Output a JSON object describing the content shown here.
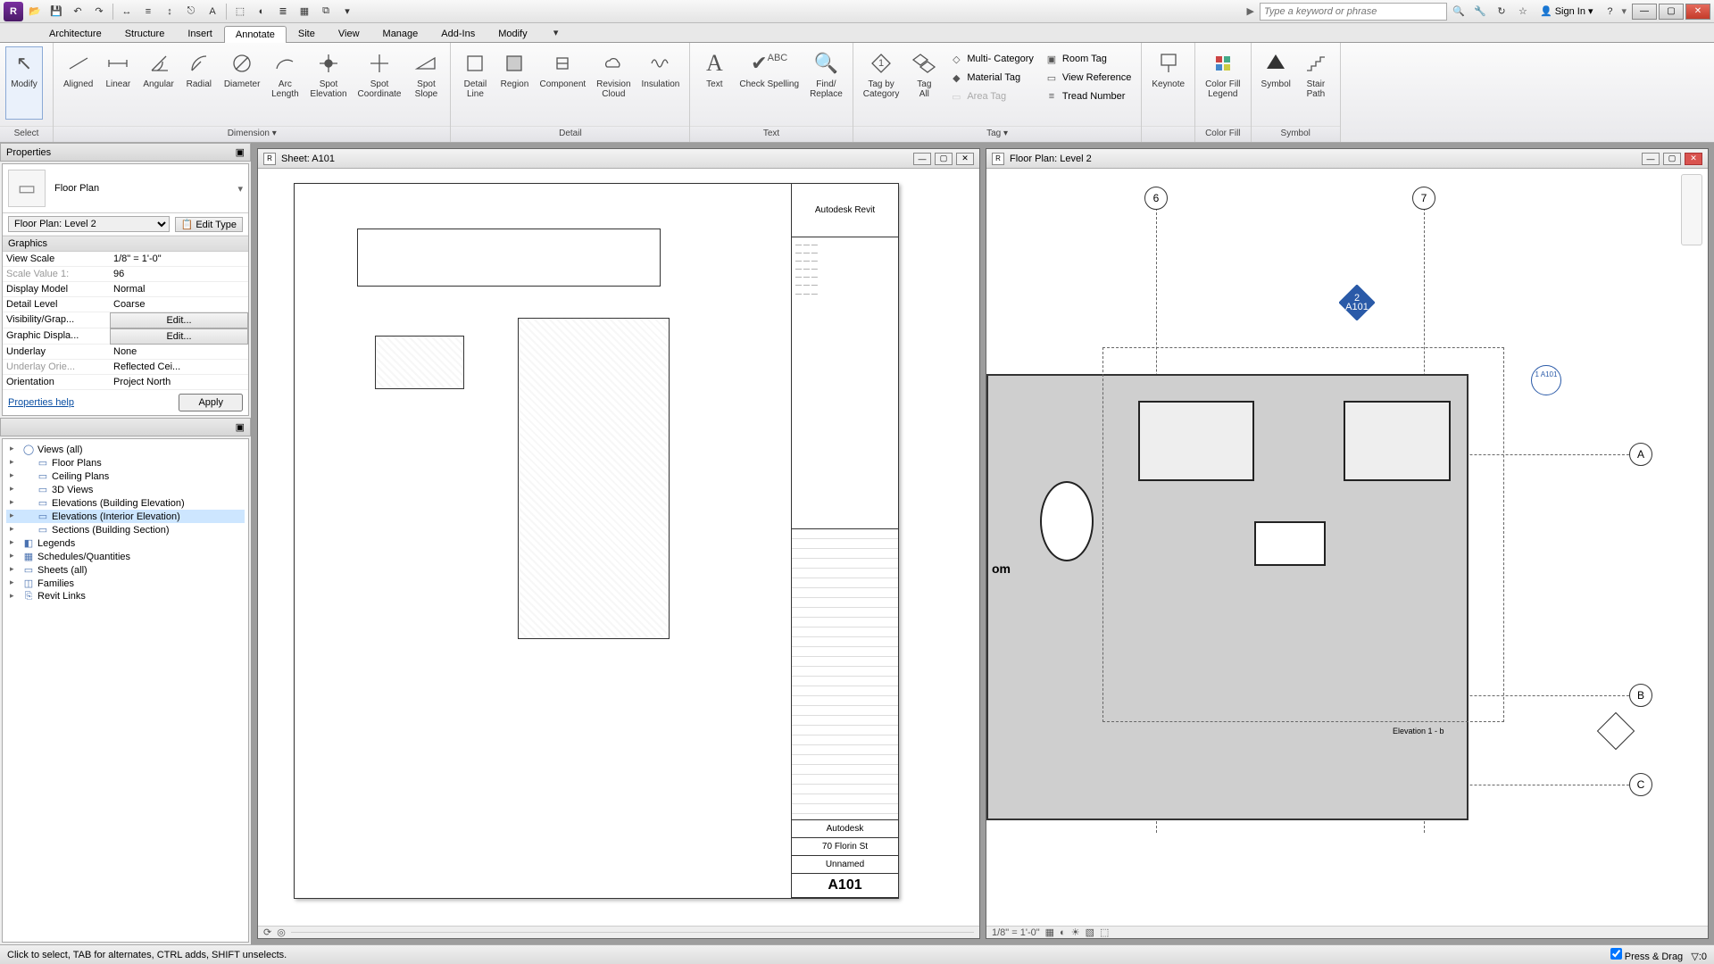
{
  "qat": {
    "search_placeholder": "Type a keyword or phrase",
    "signin_label": "Sign In"
  },
  "tabs": [
    "Architecture",
    "Structure",
    "Insert",
    "Annotate",
    "Site",
    "View",
    "Manage",
    "Add-Ins",
    "Modify"
  ],
  "active_tab": "Annotate",
  "ribbon": {
    "select": {
      "modify": "Modify",
      "title": "Select"
    },
    "dimension": {
      "aligned": "Aligned",
      "linear": "Linear",
      "angular": "Angular",
      "radial": "Radial",
      "diameter": "Diameter",
      "arc": "Arc\nLength",
      "spot_elev": "Spot\nElevation",
      "spot_coord": "Spot\nCoordinate",
      "spot_slope": "Spot\nSlope",
      "title": "Dimension ▾"
    },
    "detail": {
      "detail_line": "Detail\nLine",
      "region": "Region",
      "component": "Component",
      "revision": "Revision\nCloud",
      "insulation": "Insulation",
      "title": "Detail"
    },
    "text": {
      "text": "Text",
      "spell": "Check Spelling",
      "find": "Find/\nReplace",
      "title": "Text"
    },
    "tag": {
      "tag_cat": "Tag by\nCategory",
      "tag_all": "Tag\nAll",
      "multi": "Multi- Category",
      "material": "Material  Tag",
      "area": "Area  Tag",
      "room": "Room  Tag",
      "view": "View  Reference",
      "tread": "Tread  Number",
      "title": "Tag ▾"
    },
    "keynote": {
      "keynote": "Keynote"
    },
    "colorfill": {
      "legend": "Color Fill\nLegend",
      "title": "Color Fill"
    },
    "symbol": {
      "symbol": "Symbol",
      "stair": "Stair\nPath",
      "title": "Symbol"
    }
  },
  "properties": {
    "header": "Properties",
    "type_name": "Floor Plan",
    "instance": "Floor Plan: Level 2",
    "edit_type": "Edit Type",
    "section": "Graphics",
    "rows": [
      {
        "k": "View Scale",
        "v": "1/8\" = 1'-0\"",
        "kind": "select"
      },
      {
        "k": "Scale Value    1:",
        "v": "96",
        "kind": "readonly"
      },
      {
        "k": "Display Model",
        "v": "Normal",
        "kind": "select"
      },
      {
        "k": "Detail Level",
        "v": "Coarse",
        "kind": "select"
      },
      {
        "k": "Visibility/Grap...",
        "v": "Edit...",
        "kind": "btn"
      },
      {
        "k": "Graphic Displa...",
        "v": "Edit...",
        "kind": "btn"
      },
      {
        "k": "Underlay",
        "v": "None",
        "kind": "select"
      },
      {
        "k": "Underlay Orie...",
        "v": "Reflected Cei...",
        "kind": "readonly"
      },
      {
        "k": "Orientation",
        "v": "Project North",
        "kind": "select"
      }
    ],
    "help": "Properties help",
    "apply": "Apply"
  },
  "browser": {
    "items": [
      {
        "label": "Views (all)",
        "sel": false,
        "icon": "◯"
      },
      {
        "label": "Floor Plans",
        "indent": 1,
        "icon": "▭"
      },
      {
        "label": "Ceiling Plans",
        "indent": 1,
        "icon": "▭"
      },
      {
        "label": "3D Views",
        "indent": 1,
        "icon": "▭"
      },
      {
        "label": "Elevations (Building Elevation)",
        "indent": 1,
        "icon": "▭"
      },
      {
        "label": "Elevations (Interior Elevation)",
        "indent": 1,
        "icon": "▭",
        "sel": true
      },
      {
        "label": "Sections (Building Section)",
        "indent": 1,
        "icon": "▭"
      },
      {
        "label": "Legends",
        "icon": "◧"
      },
      {
        "label": "Schedules/Quantities",
        "icon": "▦"
      },
      {
        "label": "Sheets (all)",
        "icon": "▭"
      },
      {
        "label": "Families",
        "icon": "◫"
      },
      {
        "label": "Revit Links",
        "icon": "⎘"
      }
    ]
  },
  "sheet_view": {
    "title": "Sheet: A101",
    "titleblock_title": "Autodesk Revit",
    "author": "Autodesk",
    "address": "70 Florin St",
    "project": "Unnamed",
    "sheet_no": "A101"
  },
  "plan_view": {
    "title": "Floor Plan: Level 2",
    "grids_v": [
      "6",
      "7"
    ],
    "grids_h": [
      "A",
      "B",
      "C"
    ],
    "callout": "2\nA101",
    "section": "1\nA101",
    "elev_label": "Elevation 1 - b",
    "room_label": "om",
    "scale": "1/8\" = 1'-0\""
  },
  "status": {
    "hint": "Click to select, TAB for alternates, CTRL adds, SHIFT unselects.",
    "press_drag": "Press & Drag"
  }
}
